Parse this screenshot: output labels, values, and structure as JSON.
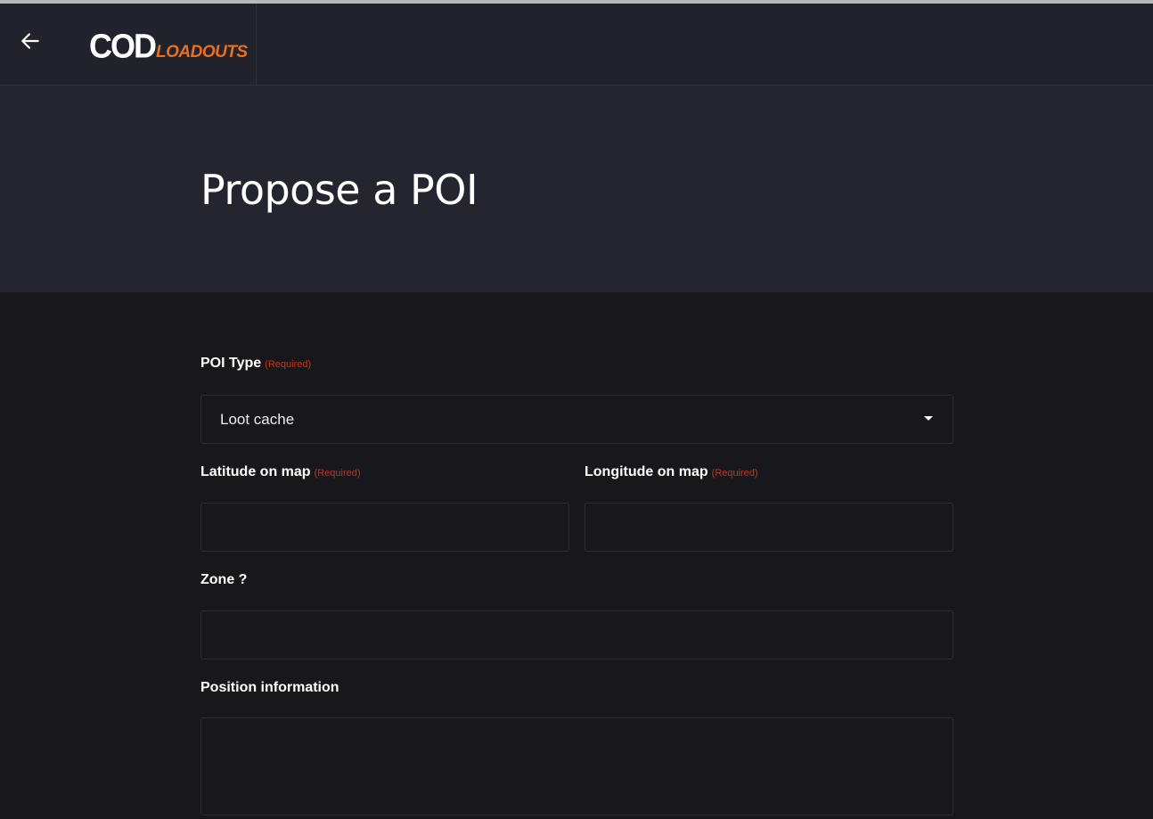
{
  "header": {
    "back_icon": "arrow-left-icon",
    "logo": {
      "primary": "COD",
      "secondary": "LOADOUTS",
      "accent_color": "#e8701e"
    }
  },
  "page": {
    "title": "Propose a POI"
  },
  "form": {
    "required_text": "(Required)",
    "required_color": "#c2361f",
    "poi_type": {
      "label": "POI Type",
      "selected": "Loot cache",
      "icon": "caret-down-icon"
    },
    "latitude": {
      "label": "Latitude on map",
      "value": ""
    },
    "longitude": {
      "label": "Longitude on map",
      "value": ""
    },
    "zone": {
      "label": "Zone ?",
      "value": ""
    },
    "position_information": {
      "label": "Position information",
      "value": ""
    }
  }
}
